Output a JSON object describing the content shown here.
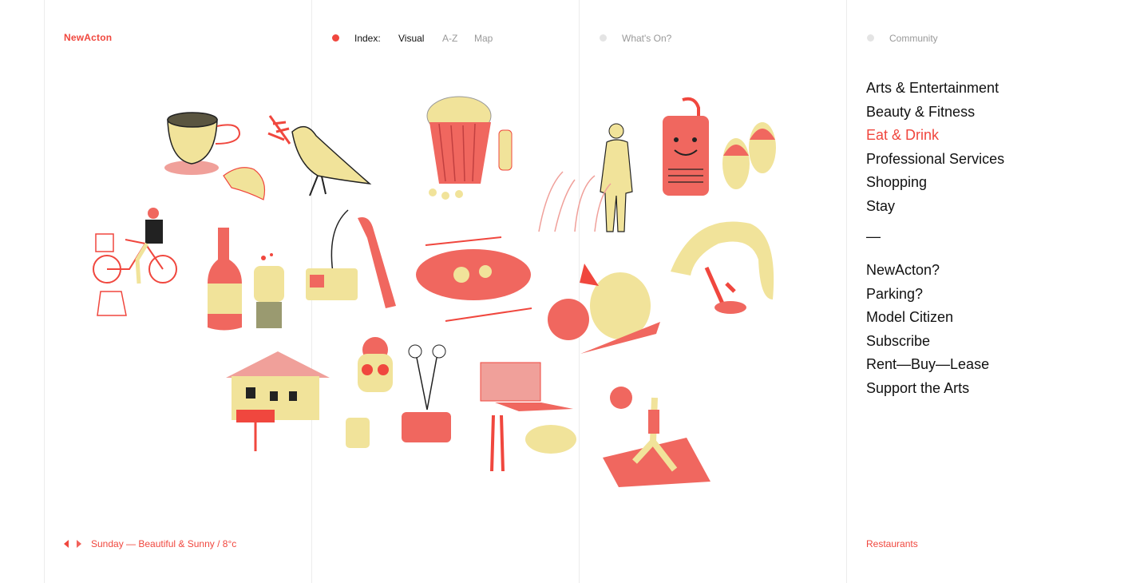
{
  "brand": "NewActon",
  "index": {
    "label": "Index:",
    "options": [
      "Visual",
      "A-Z",
      "Map"
    ],
    "active": "Visual"
  },
  "whats_on": "What's On?",
  "community": "Community",
  "categories": [
    "Arts & Entertainment",
    "Beauty & Fitness",
    "Eat & Drink",
    "Professional Services",
    "Shopping",
    "Stay"
  ],
  "active_category": "Eat & Drink",
  "separator": "—",
  "links": [
    "NewActon?",
    "Parking?",
    "Model Citizen",
    "Subscribe",
    "Rent—Buy—Lease",
    "Support the Arts"
  ],
  "weather": "Sunday — Beautiful & Sunny / 8°c",
  "current_section": "Restaurants",
  "colors": {
    "accent": "#f0473e",
    "yellow": "#f1e39a",
    "ink": "#111111",
    "muted": "#999999",
    "rule": "#ececec"
  }
}
